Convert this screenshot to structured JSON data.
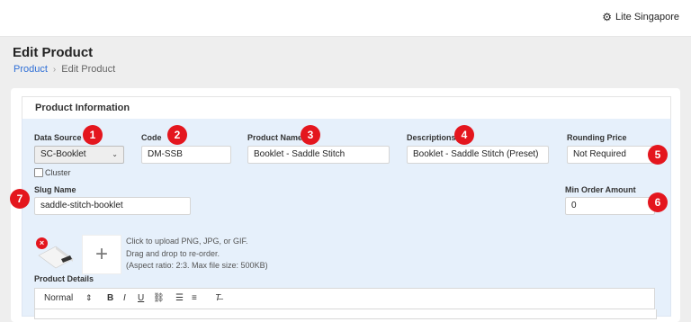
{
  "header": {
    "store_name": "Lite Singapore"
  },
  "page": {
    "title": "Edit Product",
    "breadcrumb": [
      "Product",
      "Edit Product"
    ]
  },
  "section": {
    "title": "Product Information"
  },
  "form": {
    "data_source": {
      "label": "Data Source",
      "value": "SC-Booklet"
    },
    "code": {
      "label": "Code",
      "value": "DM-SSB"
    },
    "product_name": {
      "label": "Product Name",
      "value": "Booklet - Saddle Stitch"
    },
    "descriptions": {
      "label": "Descriptions",
      "value": "Booklet - Saddle Stitch (Preset)"
    },
    "rounding_price": {
      "label": "Rounding Price",
      "value": "Not Required"
    },
    "cluster": {
      "label": "Cluster",
      "checked": false
    },
    "slug_name": {
      "label": "Slug Name",
      "value": "saddle-stitch-booklet"
    },
    "min_order_amount": {
      "label": "Min Order Amount",
      "value": "0"
    }
  },
  "upload": {
    "lines": [
      "Click to upload PNG, JPG, or GIF.",
      "Drag and drop to re-order.",
      "(Aspect ratio: 2:3. Max file size: 500KB)"
    ],
    "plus": "+",
    "remove": "×"
  },
  "details": {
    "label": "Product Details",
    "toolbar": {
      "style": "Normal",
      "bold": "B",
      "italic": "I",
      "underline": "U"
    }
  },
  "badges": [
    "1",
    "2",
    "3",
    "4",
    "5",
    "6",
    "7"
  ],
  "colors": {
    "badge": "#e4161e",
    "section_bg": "#e6f0fb",
    "link": "#2f6fd6"
  }
}
